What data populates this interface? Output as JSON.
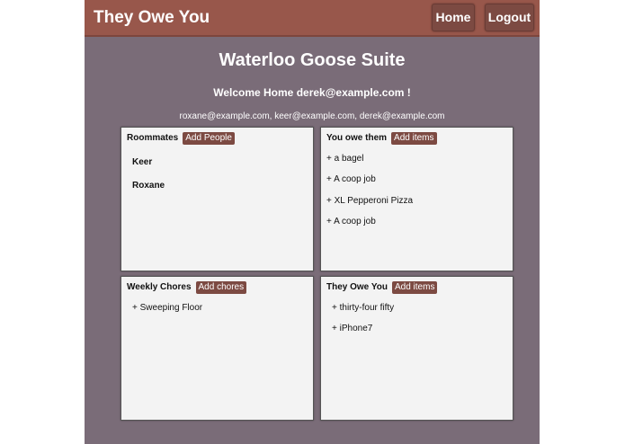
{
  "navbar": {
    "brand": "They Owe You",
    "home_label": "Home",
    "logout_label": "Logout"
  },
  "suite": {
    "title": "Waterloo Goose Suite",
    "welcome": "Welcome Home derek@example.com !",
    "members": "roxane@example.com, keer@example.com, derek@example.com"
  },
  "panels": {
    "roommates": {
      "title": "Roommates",
      "add_label": "Add People",
      "items": [
        "Keer",
        "Roxane"
      ]
    },
    "you_owe": {
      "title": "You owe them",
      "add_label": "Add items",
      "items": [
        "+ a bagel",
        "+ A coop job",
        "+ XL Pepperoni Pizza",
        "+ A coop job"
      ]
    },
    "chores": {
      "title": "Weekly Chores",
      "add_label": "Add chores",
      "items": [
        "+ Sweeping Floor"
      ]
    },
    "they_owe": {
      "title": "They Owe You",
      "add_label": "Add items",
      "items": [
        "+ thirty-four fifty",
        "+ iPhone7"
      ]
    }
  }
}
